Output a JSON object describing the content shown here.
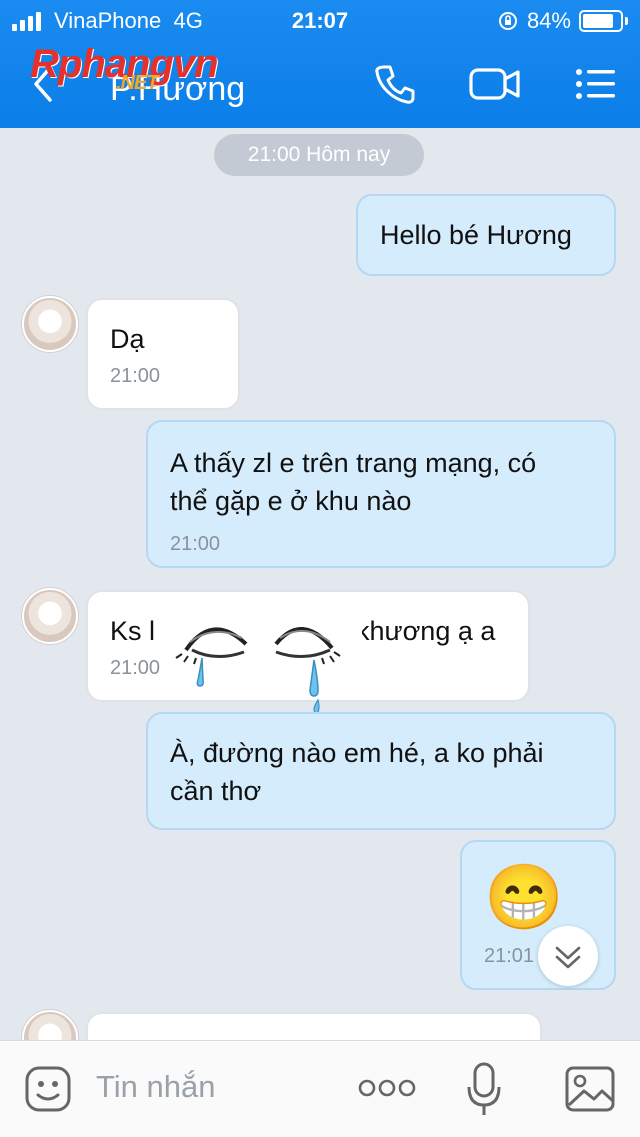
{
  "status_bar": {
    "carrier": "VinaPhone",
    "network": "4G",
    "time": "21:07",
    "battery": "84%"
  },
  "header": {
    "watermark": "Rphangvn",
    "watermark_suffix": ".NET",
    "contact_name": "P.Hương"
  },
  "chat": {
    "date_separator": "21:00 Hôm nay",
    "messages": [
      {
        "side": "sent",
        "text": "Hello bé Hương"
      },
      {
        "side": "received",
        "text": "Dạ",
        "time": "21:00"
      },
      {
        "side": "sent",
        "line1": "A thấy zl e trên trang mạng, có",
        "line2": "thể gặp e ở khu nào",
        "time": "21:00"
      },
      {
        "side": "received",
        "text_start": "Ks l",
        "text_end": "khương ạ a",
        "time": "21:00"
      },
      {
        "side": "sent",
        "line1": "À, đường nào em hé, a ko phải",
        "line2": "cần thơ"
      },
      {
        "side": "sent",
        "emoji": "😁",
        "time": "21:01"
      }
    ]
  },
  "composer": {
    "placeholder": "Tin nhắn"
  },
  "icons": [
    "back-icon",
    "phone-icon",
    "video-icon",
    "menu-icon",
    "scroll-down-icon",
    "sticker-icon",
    "more-icon",
    "mic-icon",
    "image-icon"
  ],
  "colors": {
    "header": "#0b7ee8",
    "sent_bubble": "#d4ecfb",
    "received_bubble": "#ffffff",
    "background": "#e3e8ef"
  }
}
